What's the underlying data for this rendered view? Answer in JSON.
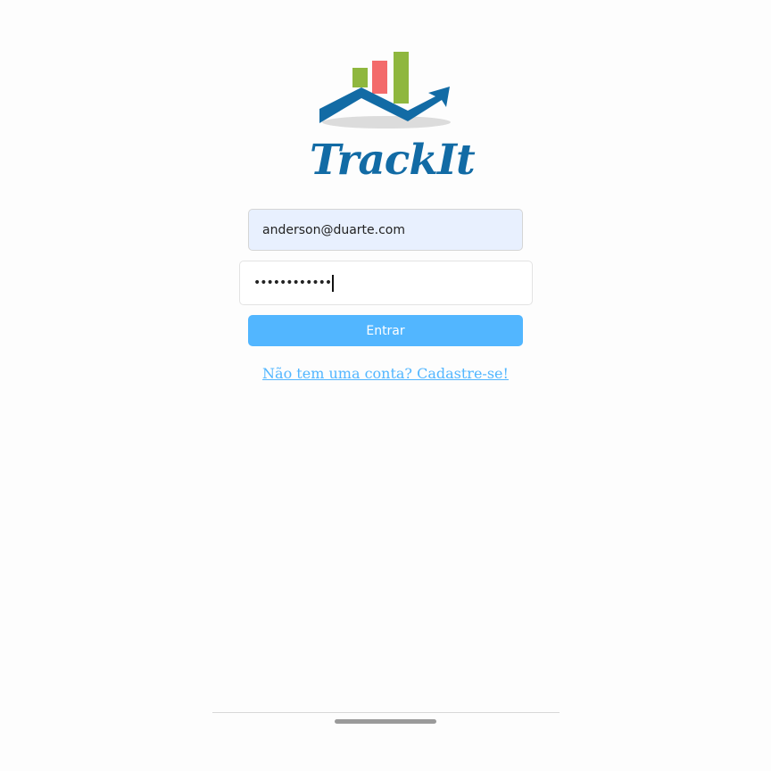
{
  "brand": {
    "name": "TrackIt",
    "colors": {
      "primary": "#126ba5",
      "bar_green": "#8fb73e",
      "bar_red": "#f36b6b",
      "accent": "#52b6ff"
    }
  },
  "login_form": {
    "email_value": "anderson@duarte.com",
    "password_masked": "••••••••••••",
    "submit_label": "Entrar",
    "signup_link_label": "Não tem uma conta? Cadastre-se!"
  },
  "icons": {
    "logo": "trackit-logo-chart-arrow-icon"
  }
}
